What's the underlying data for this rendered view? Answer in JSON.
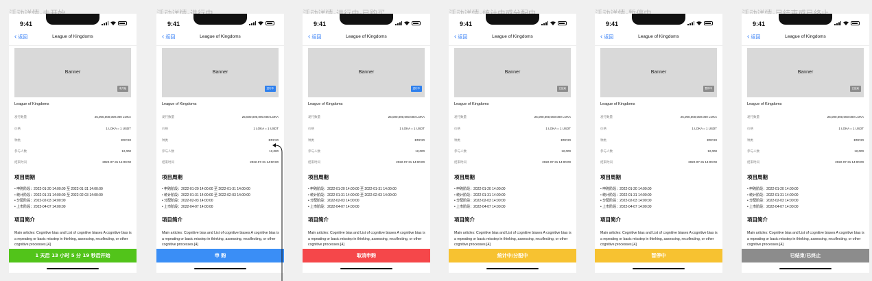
{
  "app": {
    "time": "9:41",
    "nav_title": "League of Kingdoms",
    "back_label": "返回",
    "banner_label": "Banner",
    "project_name": "League of Kingdoms",
    "section_period": "项目周期",
    "section_intro": "项目简介",
    "intro_text": "Main articles: Cognitive bias and List of cognitive biases A cognitive bias is a repeating or basic misstep in thinking, assessing, recollecting, or other cognitive processes.[4]"
  },
  "screens": [
    {
      "title": "活动详情-未开始",
      "badge": "未开始",
      "badge_color": "#8c8c8c",
      "info": [
        {
          "label": "发行数量",
          "value": "25,000,000,000.000 LOKA"
        },
        {
          "label": "价格",
          "value": "1 LOKA = 1 USDT"
        },
        {
          "label": "种类",
          "value": "ERC20"
        },
        {
          "label": "参与人数",
          "value": "12,000"
        },
        {
          "label": "结束时间",
          "value": "2022-07-31 14:00:00"
        }
      ],
      "periods": [
        "申购阶段：2022-01-20 14:00:00 至 2022-01-31 14:00:00",
        "统计阶段：2022-01-31 14:00:00 至 2022-02-03 14:00:00",
        "分配阶段：2022-02-03 14:00:00",
        "上市阶段：2022-04-07 14:00:00"
      ],
      "action_label": "1 天后 13 小时 5 分 19 秒后开始",
      "action_color": "#52c41a"
    },
    {
      "title": "活动详情-进行中",
      "badge": "进行中",
      "badge_color": "#2f80ed",
      "info": [
        {
          "label": "发行数量",
          "value": "25,000,000,000.000 LOKA"
        },
        {
          "label": "价格",
          "value": "1 LOKA = 1 USDT"
        },
        {
          "label": "种类",
          "value": "ERC20"
        },
        {
          "label": "参与人数",
          "value": "12,000"
        },
        {
          "label": "结束时间",
          "value": "2022-07-31 14:00:00"
        }
      ],
      "periods": [
        "申购阶段：2022-01-20 14:00:00 至 2022-01-31 14:00:00",
        "统计阶段：2022-01-31 14:00:00 至 2022-02-03 14:00:00",
        "分配阶段：2022-02-03 14:00:00",
        "上市阶段：2022-04-07 14:00:00"
      ],
      "action_label": "申 购",
      "action_color": "#3a8ef6"
    },
    {
      "title": "活动详情-进行中-已购买",
      "badge": "进行中",
      "badge_color": "#2f80ed",
      "info": [
        {
          "label": "发行数量",
          "value": "25,000,000,000.000 LOKA"
        },
        {
          "label": "价格",
          "value": "1 LOKA = 1 USDT"
        },
        {
          "label": "种类",
          "value": "ERC20"
        },
        {
          "label": "参与人数",
          "value": "12,000"
        },
        {
          "label": "结束时间",
          "value": "2022-07-31 14:00:00"
        }
      ],
      "periods": [
        "申购阶段：2022-01-20 14:00:00 至 2022-01-31 14:00:00",
        "统计阶段：2022-01-31 14:00:00 至 2022-02-03 14:00:00",
        "分配阶段：2022-02-03 14:00:00",
        "上市阶段：2022-04-07 14:00:00"
      ],
      "action_label": "取消申购",
      "action_color": "#f5474a"
    },
    {
      "title": "活动详情-统计中或分配中",
      "badge": "已结束",
      "badge_color": "#8c8c8c",
      "info": [
        {
          "label": "发行数量",
          "value": "25,000,000,000.000 LOKA"
        },
        {
          "label": "价格",
          "value": "1 LOKA = 1 USDT"
        },
        {
          "label": "种类",
          "value": "ERC20"
        },
        {
          "label": "参与人数",
          "value": "12,000"
        },
        {
          "label": "结束时间",
          "value": "2022-07-31 14:00:00"
        }
      ],
      "periods": [
        "申购阶段：2022-01-20 14:00:00",
        "统计阶段：2022-01-31 14:00:00",
        "分配阶段：2022-02-03 14:00:00",
        "上市阶段：2022-04-07 14:00:00"
      ],
      "action_label": "统计中/分配中",
      "action_color": "#f7c231"
    },
    {
      "title": "活动详情-暂停中",
      "badge": "暂停中",
      "badge_color": "#8c8c8c",
      "info": [
        {
          "label": "发行数量",
          "value": "25,000,000,000.000 LOKA"
        },
        {
          "label": "价格",
          "value": "1 LOKA = 1 USDT"
        },
        {
          "label": "种类",
          "value": "ERC20"
        },
        {
          "label": "参与人数",
          "value": "12,000"
        },
        {
          "label": "结束时间",
          "value": "2022-07-31 14:00:00"
        }
      ],
      "periods": [
        "申购阶段：2022-01-20 14:00:00",
        "统计阶段：2022-01-31 14:00:00",
        "分配阶段：2022-02-03 14:00:00",
        "上市阶段：2022-04-07 14:00:00"
      ],
      "action_label": "暂停中",
      "action_color": "#f7c231"
    },
    {
      "title": "活动详情-已结束或已终止",
      "badge": "已结束",
      "badge_color": "#8c8c8c",
      "info": [
        {
          "label": "发行数量",
          "value": "25,000,000,000.000 LOKA"
        },
        {
          "label": "价格",
          "value": "1 LOKA = 1 USDT"
        },
        {
          "label": "种类",
          "value": "ERC20"
        },
        {
          "label": "参与人数",
          "value": "12,000"
        },
        {
          "label": "结束时间",
          "value": "2022-07-31 14:00:00"
        }
      ],
      "periods": [
        "申购阶段：2022-01-20 14:00:00",
        "统计阶段：2022-01-31 14:00:00",
        "分配阶段：2022-02-03 14:00:00",
        "上市阶段：2022-04-07 14:00:00"
      ],
      "action_label": "已结束/已终止",
      "action_color": "#8c8c8c"
    }
  ]
}
